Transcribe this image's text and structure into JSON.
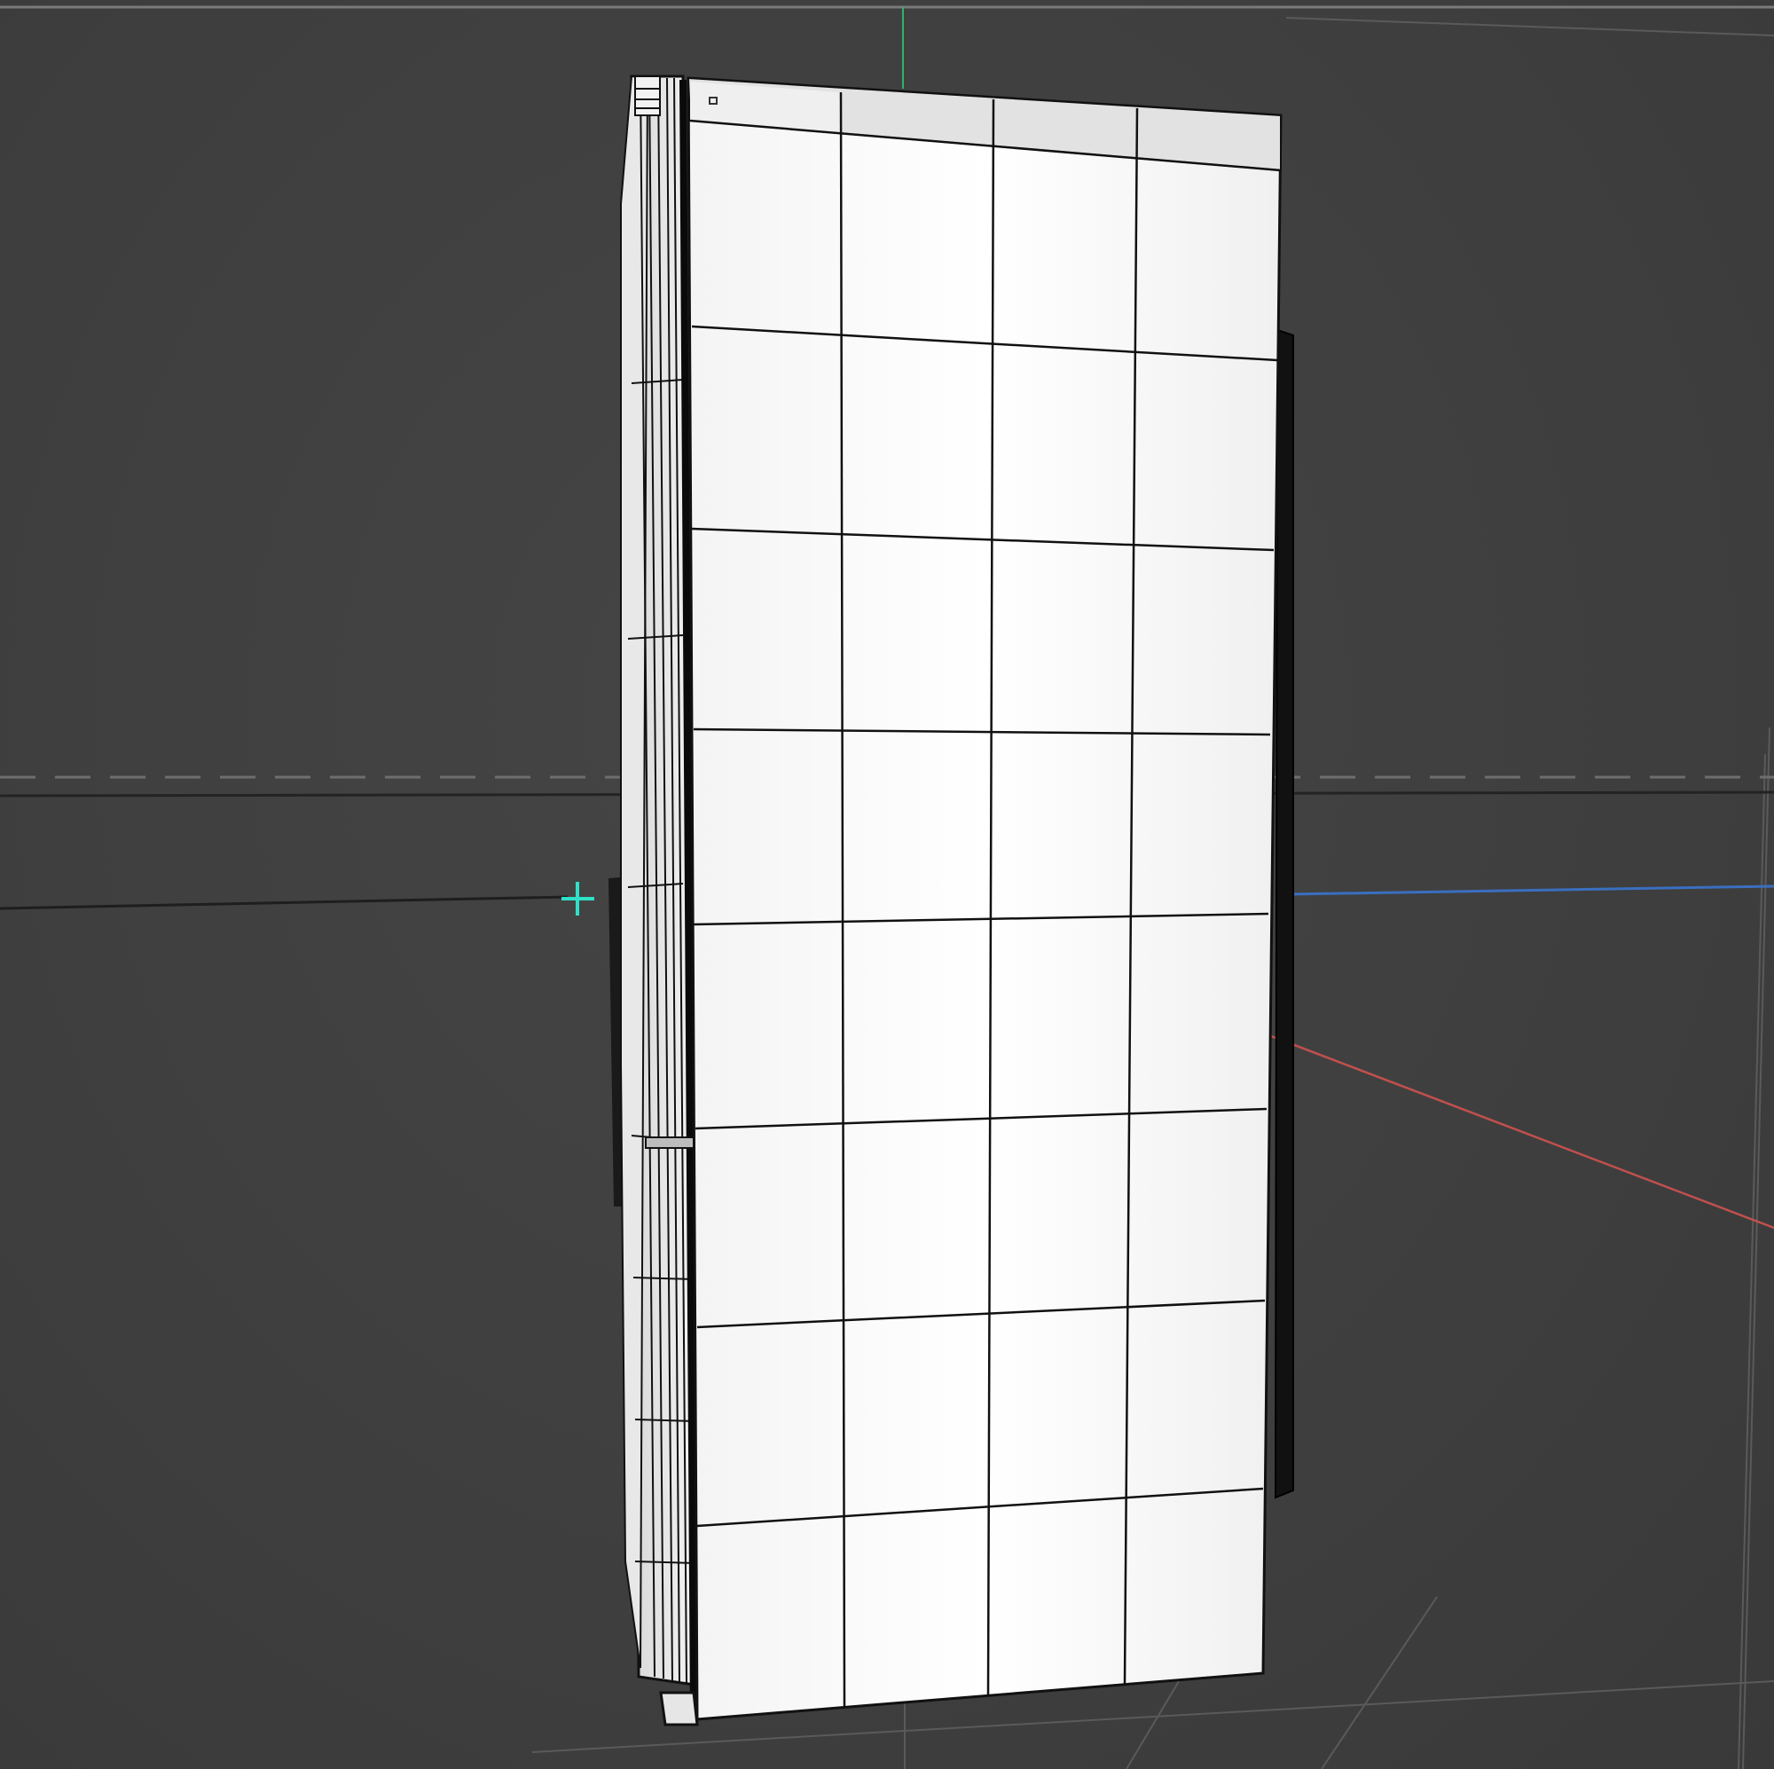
{
  "viewport": {
    "kind": "3d-perspective-viewport",
    "shading": "wireframe-on-shaded",
    "background_color": "#3f3f3f",
    "grid_color": "#5a5a5a",
    "axes": {
      "x_color": "#c0504d",
      "y_color": "#2fb36a",
      "z_color": "#3a6fc0"
    },
    "pivot_color": "#2fe0c8"
  },
  "object": {
    "name_icon": "refrigerator-mesh",
    "fill_color": "#ffffff",
    "edge_color": "#111111",
    "front_columns": 4,
    "front_rows": 8
  }
}
